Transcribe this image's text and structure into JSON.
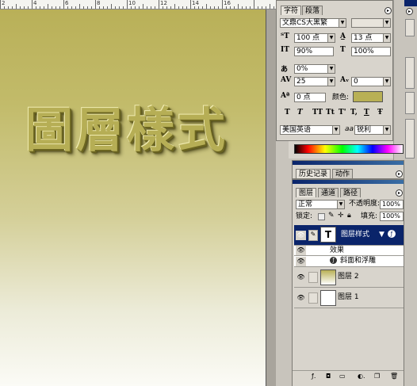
{
  "canvas": {
    "title": "圖層樣式"
  },
  "ruler": {
    "numbers": [
      "2",
      "4",
      "6",
      "8",
      "10",
      "12",
      "14",
      "16"
    ]
  },
  "character_panel": {
    "tabs": [
      "字符",
      "段落"
    ],
    "font_family": "文鼎CS大黑繁",
    "font_size": "100 点",
    "leading": "13 点",
    "vertical_scale": "90%",
    "horizontal_scale": "100%",
    "tracking_pct": "0%",
    "tracking": "25",
    "kerning": "0",
    "baseline_shift": "0 点",
    "color_label": "颜色:",
    "color_value": "#b8b055",
    "style_buttons": [
      "T",
      "T",
      "TT",
      "Tt",
      "T'",
      "T,",
      "T",
      "Ŧ"
    ],
    "language": "美国英语",
    "aa_label": "aa",
    "antialias": "锐利"
  },
  "history_panel": {
    "tabs": [
      "历史记录",
      "动作"
    ]
  },
  "layers_panel": {
    "tabs": [
      "图层",
      "通道",
      "路径"
    ],
    "blend_mode": "正常",
    "opacity_label": "不透明度:",
    "opacity": "100%",
    "lock_label": "锁定:",
    "fill_label": "填充:",
    "fill": "100%",
    "layers": [
      {
        "name": "图层样式",
        "type": "text",
        "selected": true,
        "thumb_glyph": "T"
      },
      {
        "name": "效果",
        "type": "effects-header"
      },
      {
        "name": "斜面和浮雕",
        "type": "effect"
      },
      {
        "name": "图层 2",
        "type": "gradient"
      },
      {
        "name": "图层 1",
        "type": "plain"
      }
    ]
  },
  "colors": {
    "accent": "#0a246a",
    "panel_bg": "#d8d4cc",
    "selected_row": "#0a246a",
    "gold": "#b8b055"
  }
}
